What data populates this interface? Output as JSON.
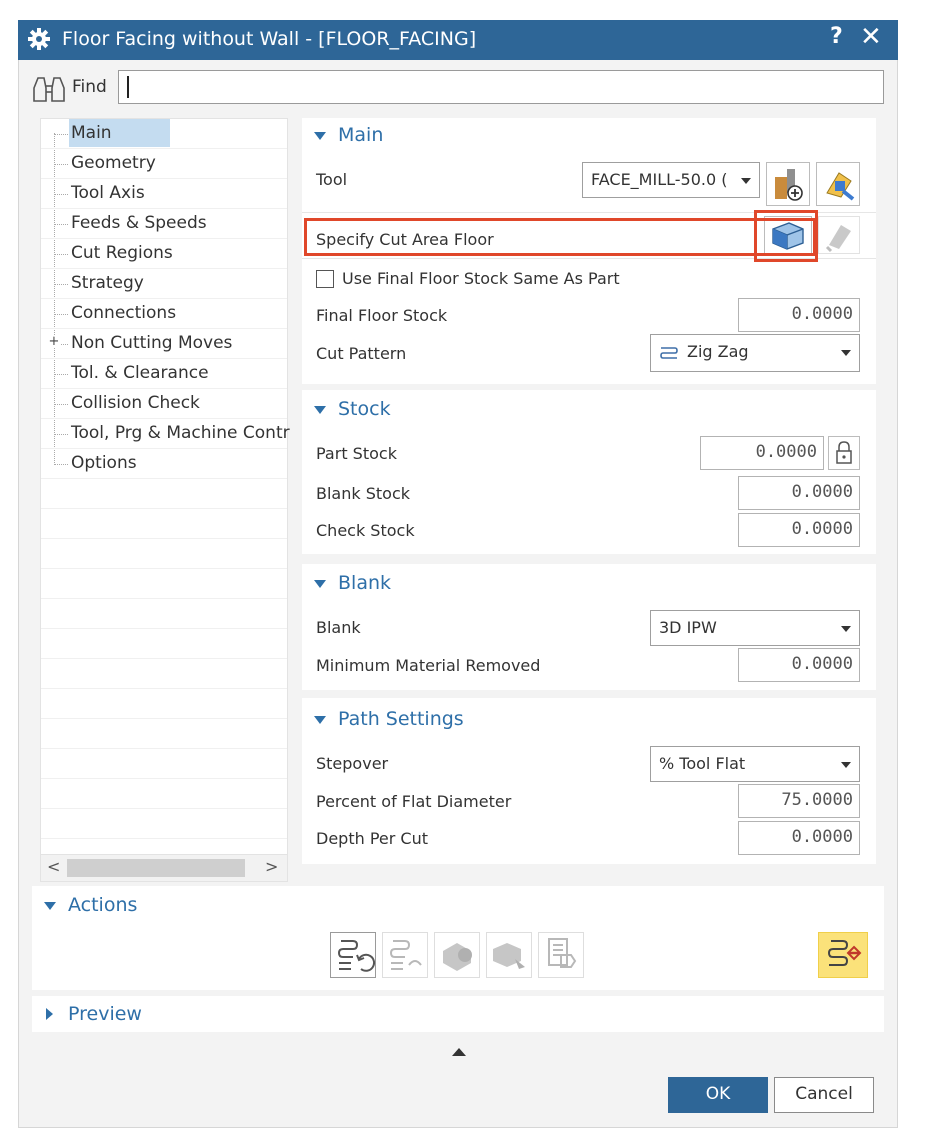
{
  "window": {
    "title": "Floor Facing without Wall - [FLOOR_FACING]",
    "help_label": "?",
    "close_label": "✕",
    "title_icon": "gear-icon"
  },
  "find": {
    "label": "Find",
    "value": "",
    "icon": "binoculars-icon"
  },
  "nav": {
    "items": [
      {
        "label": "Main",
        "selected": true
      },
      {
        "label": "Geometry"
      },
      {
        "label": "Tool Axis"
      },
      {
        "label": "Feeds & Speeds"
      },
      {
        "label": "Cut Regions"
      },
      {
        "label": "Strategy"
      },
      {
        "label": "Connections"
      },
      {
        "label": "Non Cutting Moves",
        "expandable": true
      },
      {
        "label": "Tol. & Clearance"
      },
      {
        "label": "Collision Check"
      },
      {
        "label": "Tool, Prg & Machine Contr"
      },
      {
        "label": "Options"
      }
    ],
    "scroll_left": "<",
    "scroll_right": ">"
  },
  "main": {
    "title": "Main",
    "tool_label": "Tool",
    "tool_value": "FACE_MILL-50.0 (",
    "specify_cut_area_label": "Specify Cut Area Floor",
    "use_final_floor_label": "Use Final Floor Stock Same As Part",
    "use_final_floor_checked": false,
    "final_floor_stock_label": "Final Floor Stock",
    "final_floor_stock_value": "0.0000",
    "cut_pattern_label": "Cut Pattern",
    "cut_pattern_value": "Zig Zag"
  },
  "stock": {
    "title": "Stock",
    "part_stock_label": "Part Stock",
    "part_stock_value": "0.0000",
    "blank_stock_label": "Blank Stock",
    "blank_stock_value": "0.0000",
    "check_stock_label": "Check Stock",
    "check_stock_value": "0.0000"
  },
  "blank": {
    "title": "Blank",
    "blank_label": "Blank",
    "blank_value": "3D IPW",
    "min_material_label": "Minimum Material Removed",
    "min_material_value": "0.0000"
  },
  "path_settings": {
    "title": "Path Settings",
    "stepover_label": "Stepover",
    "stepover_value": "% Tool Flat",
    "percent_flat_label": "Percent of Flat Diameter",
    "percent_flat_value": "75.0000",
    "depth_per_cut_label": "Depth Per Cut",
    "depth_per_cut_value": "0.0000"
  },
  "actions": {
    "title": "Actions"
  },
  "preview": {
    "title": "Preview"
  },
  "buttons": {
    "ok": "OK",
    "cancel": "Cancel"
  },
  "colors": {
    "title_bar": "#2e6697",
    "group_title": "#2e6fa8",
    "highlight_box": "#e0472a",
    "ok_button": "#2e6697",
    "nav_selected": "#c4dcf0"
  }
}
